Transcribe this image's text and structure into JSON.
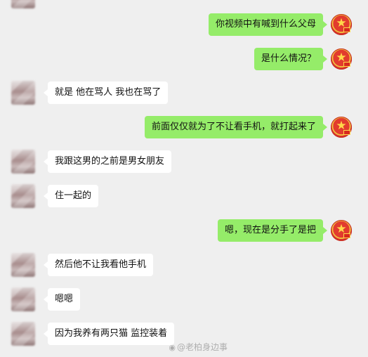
{
  "messages": [
    {
      "side": "out",
      "text": "你视频中有喊到什么父母"
    },
    {
      "side": "out",
      "text": "是什么情况？"
    },
    {
      "side": "in",
      "text": "就是 他在骂人 我也在骂了"
    },
    {
      "side": "out",
      "text": "前面仅仅就为了不让看手机，就打起来了"
    },
    {
      "side": "in",
      "text": "我跟这男的之前是男女朋友"
    },
    {
      "side": "in",
      "text": "住一起的"
    },
    {
      "side": "out",
      "text": "嗯，现在是分手了是把"
    },
    {
      "side": "in",
      "text": "然后他不让我看他手机"
    },
    {
      "side": "in",
      "text": "嗯嗯"
    },
    {
      "side": "in",
      "text": "因为我养有两只猫 监控装着"
    }
  ],
  "watermark": {
    "text": "@老柏身边事"
  },
  "colors": {
    "background": "#efefef",
    "outgoing_bubble": "#95ec69",
    "incoming_bubble": "#ffffff"
  }
}
